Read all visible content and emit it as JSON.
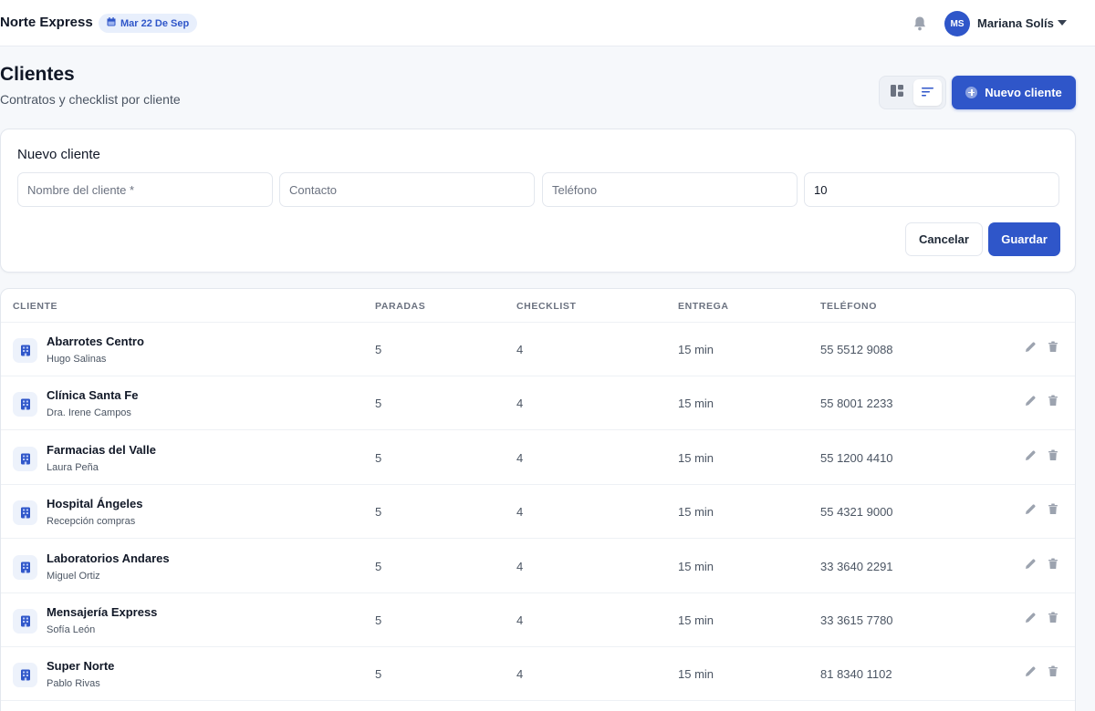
{
  "header": {
    "brand": "Norte Express",
    "date": "Mar 22 De Sep",
    "user_initials": "MS",
    "user_name": "Mariana Solís"
  },
  "page": {
    "title": "Clientes",
    "subtitle": "Contratos y checklist por cliente",
    "new_client_label": "Nuevo cliente"
  },
  "form": {
    "title": "Nuevo cliente",
    "fields": [
      {
        "placeholder": "Nombre del cliente *",
        "value": ""
      },
      {
        "placeholder": "Contacto",
        "value": ""
      },
      {
        "placeholder": "Teléfono",
        "value": ""
      },
      {
        "placeholder": "",
        "value": "10"
      }
    ],
    "cancel_label": "Cancelar",
    "save_label": "Guardar"
  },
  "table": {
    "columns": [
      "CLIENTE",
      "PARADAS",
      "CHECKLIST",
      "ENTREGA",
      "TELÉFONO"
    ],
    "rows": [
      {
        "name": "Abarrotes Centro",
        "contact": "Hugo Salinas",
        "stops": "5",
        "checklist": "4",
        "delivery": "15 min",
        "phone": "55 5512 9088"
      },
      {
        "name": "Clínica Santa Fe",
        "contact": "Dra. Irene Campos",
        "stops": "5",
        "checklist": "4",
        "delivery": "15 min",
        "phone": "55 8001 2233"
      },
      {
        "name": "Farmacias del Valle",
        "contact": "Laura Peña",
        "stops": "5",
        "checklist": "4",
        "delivery": "15 min",
        "phone": "55 1200 4410"
      },
      {
        "name": "Hospital Ángeles",
        "contact": "Recepción compras",
        "stops": "5",
        "checklist": "4",
        "delivery": "15 min",
        "phone": "55 4321 9000"
      },
      {
        "name": "Laboratorios Andares",
        "contact": "Miguel Ortiz",
        "stops": "5",
        "checklist": "4",
        "delivery": "15 min",
        "phone": "33 3640 2291"
      },
      {
        "name": "Mensajería Express",
        "contact": "Sofía León",
        "stops": "5",
        "checklist": "4",
        "delivery": "15 min",
        "phone": "33 3615 7780"
      },
      {
        "name": "Super Norte",
        "contact": "Pablo Rivas",
        "stops": "5",
        "checklist": "4",
        "delivery": "15 min",
        "phone": "81 8340 1102"
      }
    ]
  },
  "colors": {
    "accent": "#2f56c9",
    "background": "#f6f8fb",
    "chip_bg": "#e8effc"
  },
  "icons": {
    "date": "calendar-icon",
    "notifications": "bell-icon",
    "user_menu": "chevron-down-icon",
    "view_grid": "grid-view-icon",
    "view_list": "list-view-icon",
    "new_client": "plus-circle-icon",
    "row": "building-icon",
    "edit": "pencil-icon",
    "delete": "trash-icon"
  }
}
